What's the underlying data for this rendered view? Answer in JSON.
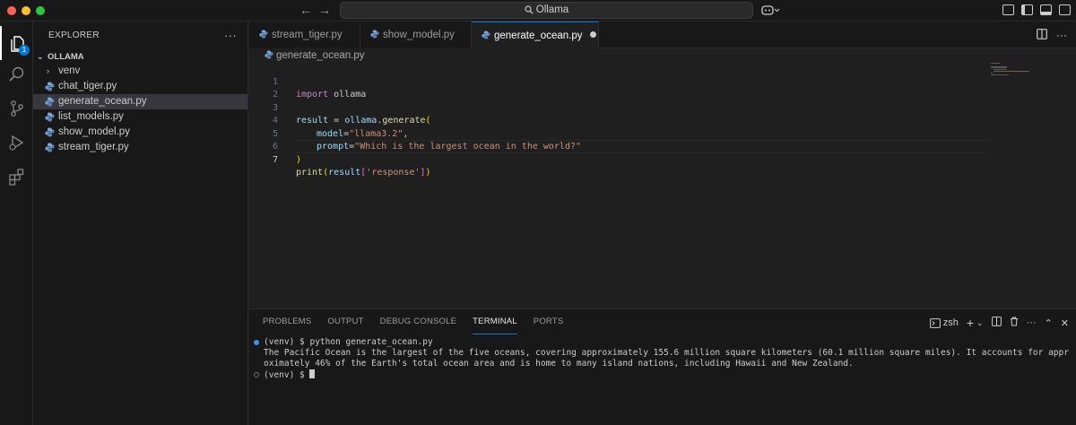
{
  "window": {
    "command_center": "Ollama"
  },
  "activity_bar": {
    "explorer_badge": "1"
  },
  "explorer": {
    "title": "EXPLORER",
    "more": "···",
    "workspace": "OLLAMA",
    "folders": [
      "venv"
    ],
    "files": [
      "chat_tiger.py",
      "generate_ocean.py",
      "list_models.py",
      "show_model.py",
      "stream_tiger.py"
    ],
    "selected_file": "generate_ocean.py"
  },
  "tabs": [
    "stream_tiger.py",
    "show_model.py",
    "generate_ocean.py"
  ],
  "active_tab": "generate_ocean.py",
  "breadcrumb": "generate_ocean.py",
  "editor": {
    "line_numbers": [
      "1",
      "2",
      "3",
      "4",
      "5",
      "6",
      "7"
    ],
    "current_line": 7,
    "code": {
      "l1_kw": "import",
      "l1_mod": " ollama",
      "l3_var": "result",
      "l3_eq": " = ",
      "l3_obj": "ollama",
      "l3_dot": ".",
      "l3_fn": "generate",
      "l3_paren": "(",
      "l4_arg": "model",
      "l4_eq": "=",
      "l4_str": "\"llama3.2\"",
      "l4_comma": ",",
      "l5_arg": "prompt",
      "l5_eq": "=",
      "l5_str": "\"Which is the largest ocean in the world?\"",
      "l6_paren": ")",
      "l7_fn": "print",
      "l7_p1": "(",
      "l7_var": "result",
      "l7_b1": "[",
      "l7_str": "'response'",
      "l7_b2": "]",
      "l7_p2": ")"
    }
  },
  "panel": {
    "tabs": [
      "PROBLEMS",
      "OUTPUT",
      "DEBUG CONSOLE",
      "TERMINAL",
      "PORTS"
    ],
    "active_tab": "TERMINAL",
    "shell": "zsh",
    "terminal": {
      "line1": "(venv) $ python generate_ocean.py",
      "line2": "The Pacific Ocean is the largest of the five oceans, covering approximately 155.6 million square kilometers (60.1 million square miles). It accounts for approximately 46% of the Earth's total ocean area and is home to many island nations, including Hawaii and New Zealand.",
      "line3": "(venv) $ "
    }
  },
  "colors": {
    "accent": "#0078d4",
    "editor_bg": "#1f1f1f",
    "sidebar_bg": "#181818"
  }
}
